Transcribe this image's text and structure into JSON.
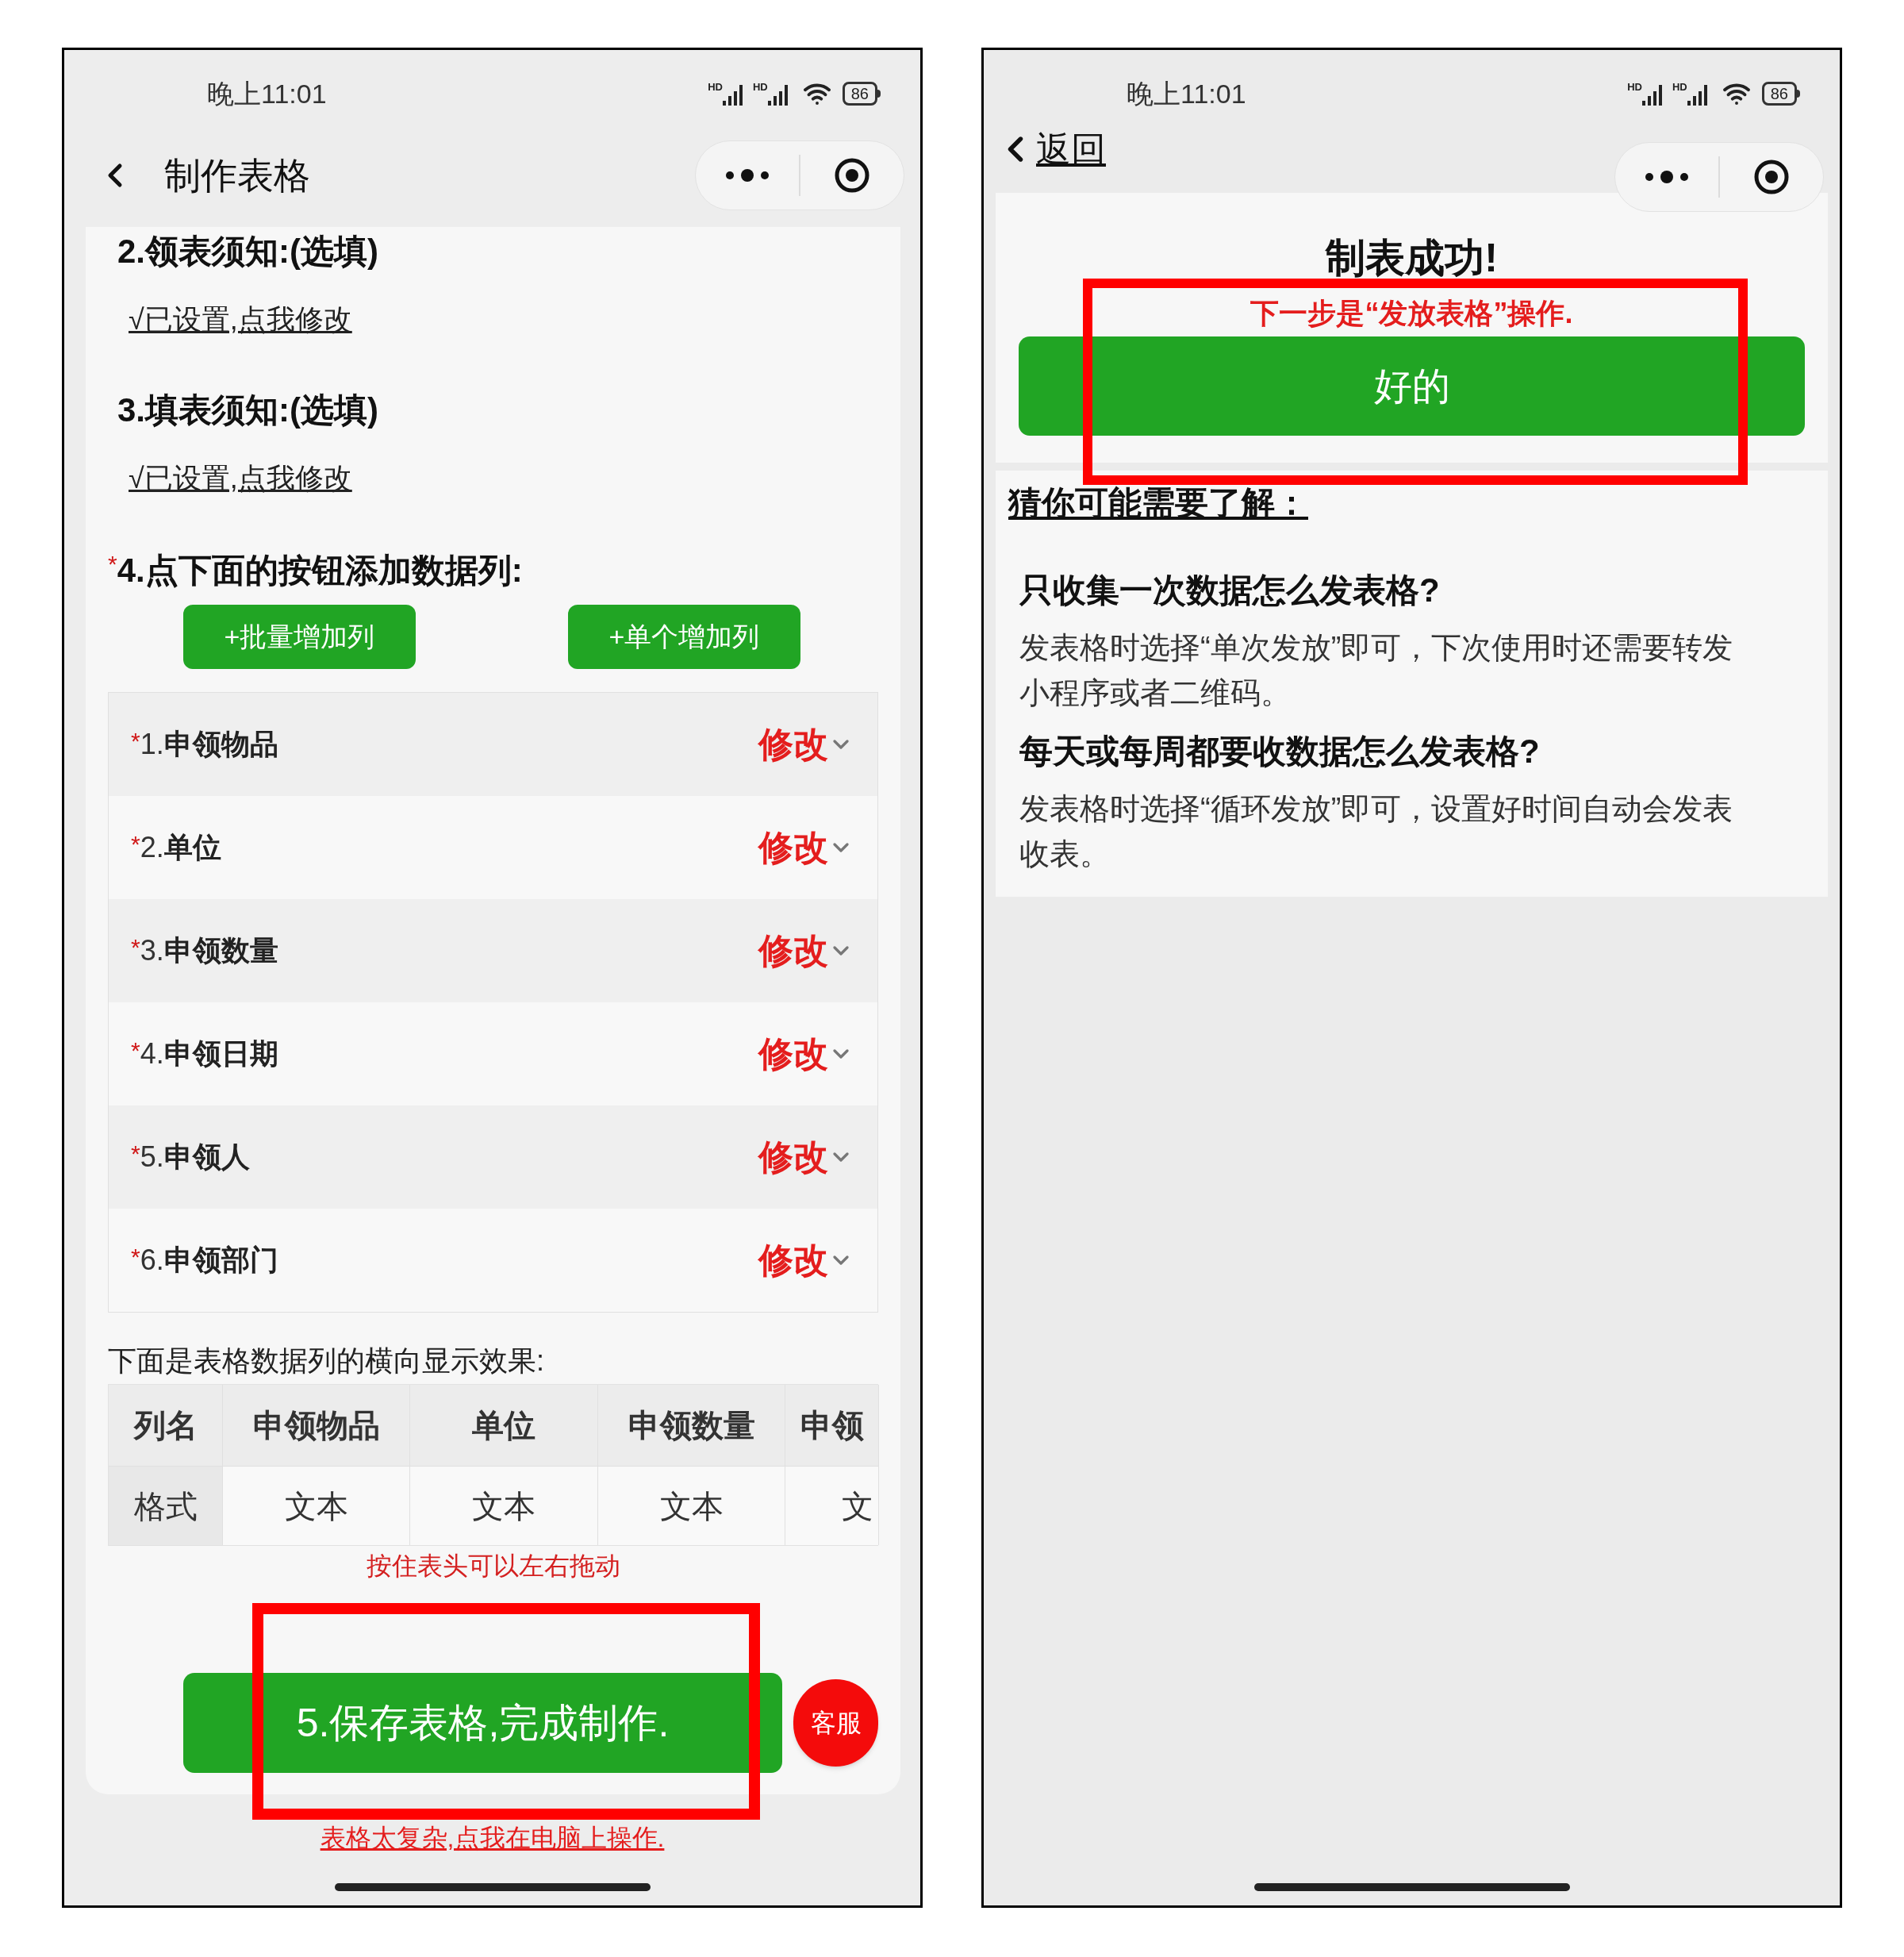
{
  "left_screen": {
    "status_bar": {
      "time": "晚上11:01",
      "signal_labels": [
        "HD",
        "HD"
      ],
      "battery": "86"
    },
    "nav": {
      "title": "制作表格"
    },
    "sections": [
      {
        "heading": "2.领表须知:(选填)",
        "link": "√已设置,点我修改"
      },
      {
        "heading": "3.填表须知:(选填)",
        "link": "√已设置,点我修改"
      }
    ],
    "columns_section": {
      "marker": "*",
      "heading": "4.点下面的按钮添加数据列:",
      "buttons": [
        "+批量增加列",
        "+单个增加列"
      ]
    },
    "columns": [
      {
        "marker": "*",
        "index": "1.",
        "name": "申领物品",
        "action": "修改"
      },
      {
        "marker": "*",
        "index": "2.",
        "name": "单位",
        "action": "修改"
      },
      {
        "marker": "*",
        "index": "3.",
        "name": "申领数量",
        "action": "修改"
      },
      {
        "marker": "*",
        "index": "4.",
        "name": "申领日期",
        "action": "修改"
      },
      {
        "marker": "*",
        "index": "5.",
        "name": "申领人",
        "action": "修改"
      },
      {
        "marker": "*",
        "index": "6.",
        "name": "申领部门",
        "action": "修改"
      }
    ],
    "preview": {
      "caption": "下面是表格数据列的横向显示效果:",
      "header": [
        "列名",
        "申领物品",
        "单位",
        "申领数量",
        "申领"
      ],
      "row": [
        "格式",
        "文本",
        "文本",
        "文本",
        "文"
      ],
      "hint": "按住表头可以左右拖动"
    },
    "save_button": "5.保存表格,完成制作.",
    "support_button": "客服",
    "desktop_link": "表格太复杂,点我在电脑上操作."
  },
  "right_screen": {
    "status_bar": {
      "time": "晚上11:01",
      "signal_labels": [
        "HD",
        "HD"
      ],
      "battery": "86"
    },
    "back_link": "返回",
    "title": "制表成功!",
    "notice": "下一步是“发放表格”操作.",
    "ok_button": "好的",
    "tips": {
      "heading": "猜你可能需要了解：",
      "items": [
        {
          "question": "只收集一次数据怎么发表格?",
          "answer": "发表格时选择“单次发放”即可，下次使用时还需要转发小程序或者二维码。"
        },
        {
          "question": "每天或每周都要收数据怎么发表格?",
          "answer": "发表格时选择“循环发放”即可，设置好时间自动会发表收表。"
        }
      ]
    }
  }
}
